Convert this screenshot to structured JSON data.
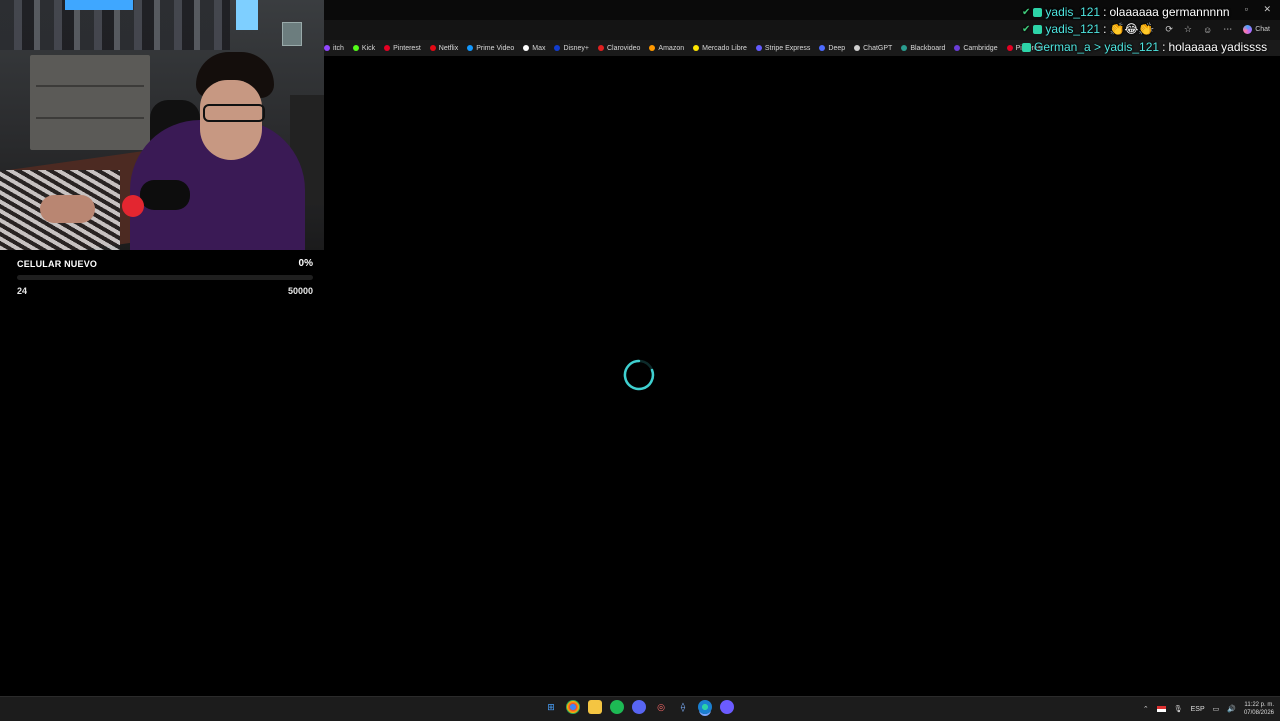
{
  "browser": {
    "bookmarks": [
      {
        "label": "itch",
        "color": "#9147ff"
      },
      {
        "label": "Kick",
        "color": "#53fc18"
      },
      {
        "label": "Pinterest",
        "color": "#e60023"
      },
      {
        "label": "Netflix",
        "color": "#e50914"
      },
      {
        "label": "Prime Video",
        "color": "#1399ff"
      },
      {
        "label": "Max",
        "color": "#ffffff"
      },
      {
        "label": "Disney+",
        "color": "#113ccf"
      },
      {
        "label": "Clarovideo",
        "color": "#e02020"
      },
      {
        "label": "Amazon",
        "color": "#ff9900"
      },
      {
        "label": "Mercado Libre",
        "color": "#ffe600"
      },
      {
        "label": "Stripe Express",
        "color": "#635bff"
      },
      {
        "label": "Deep",
        "color": "#4d6bfe"
      },
      {
        "label": "ChatGPT",
        "color": "#d0d0d0"
      },
      {
        "label": "Blackboard",
        "color": "#2a9d8f"
      },
      {
        "label": "Cambridge",
        "color": "#6a3dd8"
      },
      {
        "label": "Pinterest",
        "color": "#e60023"
      }
    ],
    "chat_button_label": "Chat"
  },
  "overlay_chat": [
    {
      "user": "yadis_121",
      "sep": ":",
      "msg": "olaaaaaa germannnnn"
    },
    {
      "user": "yadis_121",
      "sep": ":",
      "msg": "👏😂👏"
    },
    {
      "user": "German_a > yadis_121",
      "sep": ":",
      "msg": "holaaaaa yadissss"
    }
  ],
  "goal": {
    "title": "CELULAR NUEVO",
    "percent_label": "0%",
    "current": "24",
    "target": "50000",
    "progress_fraction": 0.0,
    "accent": "#2de0c2"
  },
  "taskbar": {
    "language": "ESP",
    "time": "11:22 p. m.",
    "date": "07/08/2026"
  }
}
